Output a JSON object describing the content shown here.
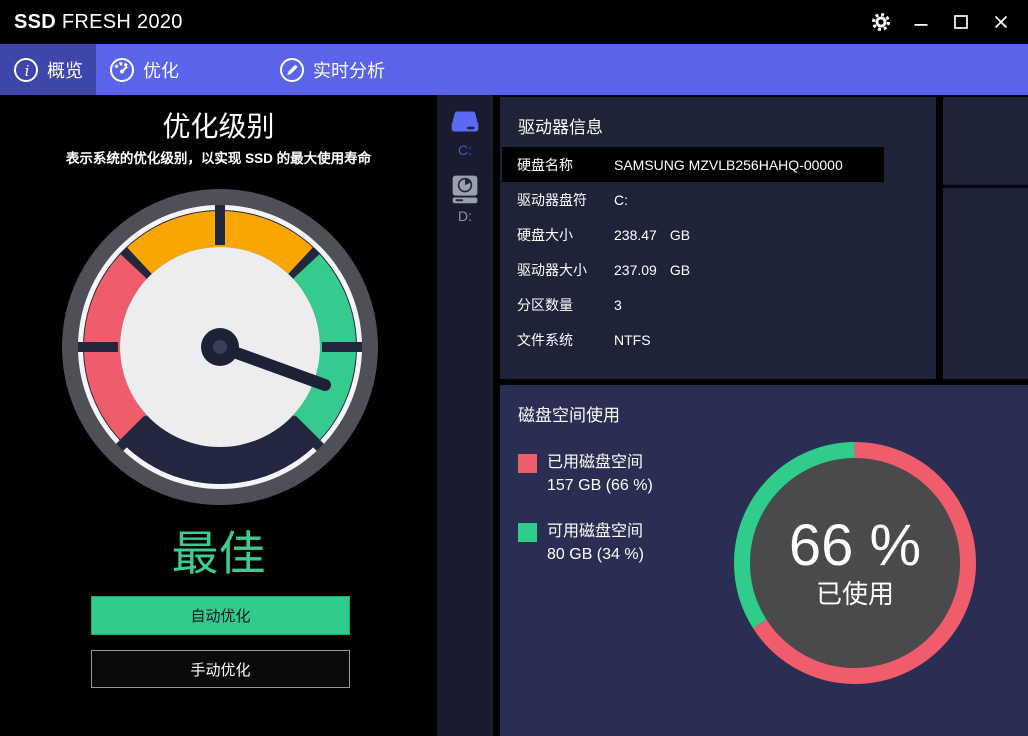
{
  "window": {
    "title_brand": "SSD",
    "title_rest": " FRESH 2020",
    "controls": [
      "settings-gear",
      "minimize",
      "maximize",
      "close"
    ]
  },
  "tabs": [
    {
      "label": "概览",
      "icon": "info-icon",
      "active": true
    },
    {
      "label": "优化",
      "icon": "speedometer-icon",
      "active": false
    },
    {
      "label": "实时分析",
      "icon": "pencil-icon",
      "active": false
    }
  ],
  "left_panel": {
    "title": "优化级别",
    "subtitle": "表示系统的优化级别，以实现 SSD 的最大使用寿命",
    "status": "最佳",
    "auto_button": "自动优化",
    "manual_button": "手动优化"
  },
  "drives": [
    {
      "letter": "C:",
      "icon": "ssd-drive-icon"
    },
    {
      "letter": "D:",
      "icon": "hdd-drive-icon"
    }
  ],
  "drive_info": {
    "title": "驱动器信息",
    "rows": [
      {
        "label": "硬盘名称",
        "value": "SAMSUNG MZVLB256HAHQ-00000",
        "unit": "",
        "highlight": true
      },
      {
        "label": "驱动器盘符",
        "value": "C:",
        "unit": ""
      },
      {
        "label": "硬盘大小",
        "value": "238.47",
        "unit": "GB"
      },
      {
        "label": "驱动器大小",
        "value": "237.09",
        "unit": "GB"
      },
      {
        "label": "分区数量",
        "value": "3",
        "unit": ""
      },
      {
        "label": "文件系统",
        "value": "NTFS",
        "unit": ""
      }
    ]
  },
  "disk_usage": {
    "title": "磁盘空间使用",
    "legend": [
      {
        "label": "已用磁盘空间",
        "detail": "157 GB (66 %)",
        "color": "#ef5d6c"
      },
      {
        "label": "可用磁盘空间",
        "detail": "80 GB (34 %)",
        "color": "#2fcc8c"
      }
    ],
    "donut": {
      "percent_label": "66 %",
      "caption": "已使用",
      "used_percent": 66,
      "free_percent": 34
    }
  },
  "colors": {
    "tabbar_blue": "#5a63ea",
    "tab_active_blue": "#3e45ab",
    "used_red": "#ef5d6c",
    "free_green": "#2fcc8c",
    "gauge_orange": "#f9a602",
    "gauge_navy": "#23273e",
    "status_green": "#3ecb8e",
    "card_dark": "#1f2338",
    "card_light": "#2a2e52",
    "donut_inner_gray": "#4a4a4d"
  }
}
